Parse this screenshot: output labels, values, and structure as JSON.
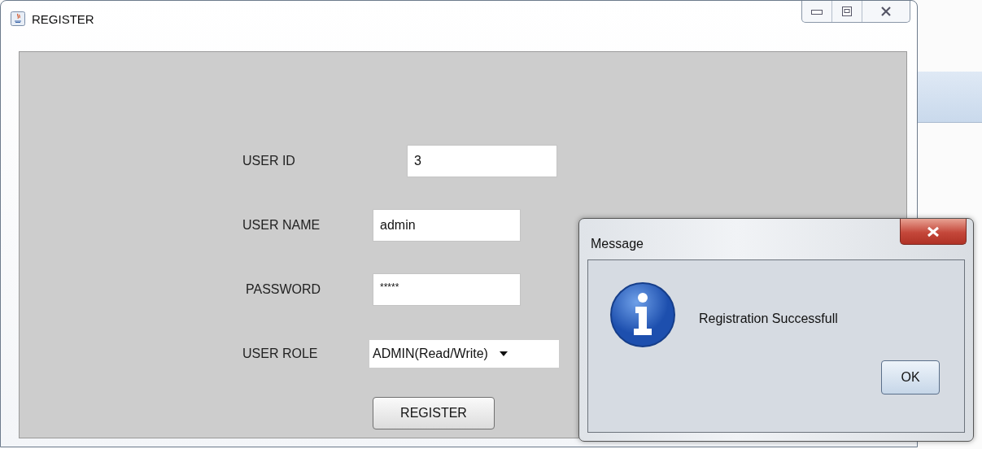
{
  "window": {
    "title": "REGISTER"
  },
  "form": {
    "fields": [
      {
        "kind": "text",
        "label": "USER ID",
        "value": "3"
      },
      {
        "kind": "text",
        "label": "USER NAME",
        "value": "admin"
      },
      {
        "kind": "password",
        "label": "PASSWORD",
        "value": "*****"
      },
      {
        "kind": "select",
        "label": "USER ROLE",
        "value": "ADMIN(Read/Write)"
      }
    ],
    "button": "REGISTER"
  },
  "dialog": {
    "title": "Message",
    "message": "Registration Successfull",
    "button": "OK"
  }
}
